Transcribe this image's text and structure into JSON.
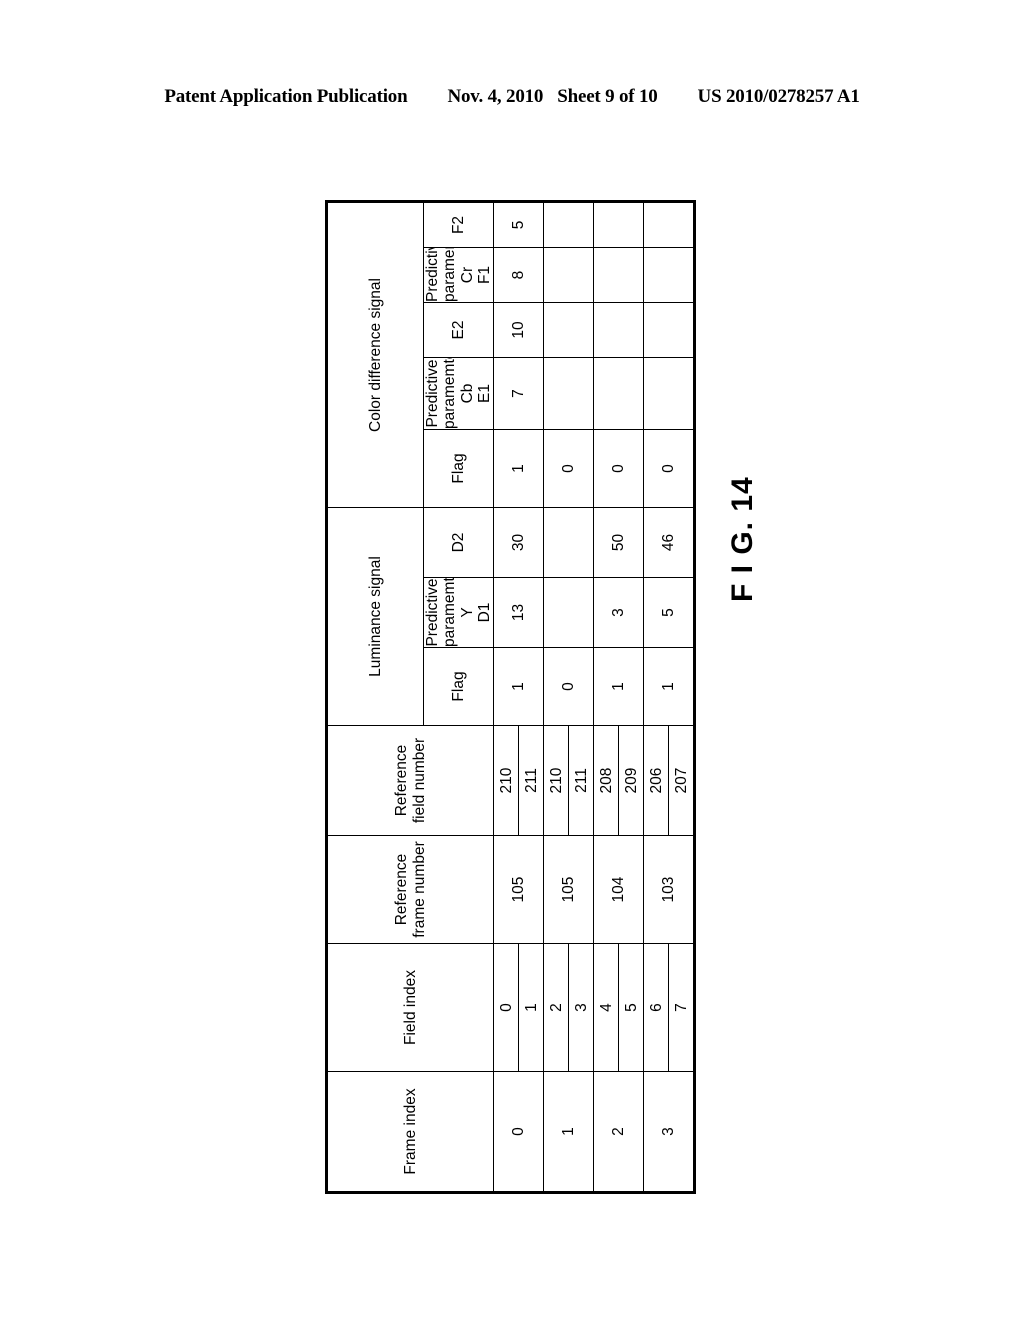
{
  "page": {
    "header": {
      "publication": "Patent Application Publication",
      "date": "Nov. 4, 2010",
      "sheet": "Sheet 9 of 10",
      "doc_number": "US 2010/0278257 A1"
    },
    "figure_label": "F I G. 14",
    "background_color": "#ffffff",
    "ink_color": "#000000"
  },
  "table": {
    "orientation": "rotated-90-ccw",
    "group_headers": {
      "color_difference": "Color difference signal",
      "luminance": "Luminance signal"
    },
    "columns": [
      {
        "key": "frame_index",
        "label": "Frame index"
      },
      {
        "key": "field_index",
        "label": "Field index"
      },
      {
        "key": "reference_frame_number",
        "label": "Reference\nframe number",
        "line1": "Reference",
        "line2": "frame number"
      },
      {
        "key": "reference_field_number",
        "label": "Reference\nfield number",
        "line1": "Reference",
        "line2": "field number"
      },
      {
        "key": "luminance_flag",
        "label": "Flag"
      },
      {
        "key": "luminance_d1",
        "group": "Predictive paramemter Y",
        "g_line1": "Predictive",
        "g_line2": "paramemter Y",
        "label": "D1"
      },
      {
        "key": "luminance_d2",
        "group": "Predictive paramemter Y",
        "g_line1": "Predictive",
        "g_line2": "paramemter Y",
        "label": "D2"
      },
      {
        "key": "color_flag",
        "label": "Flag"
      },
      {
        "key": "cb_e1",
        "group": "Predictive paramemter Cb",
        "g_line1": "Predictive",
        "g_line2": "paramemter Cb",
        "label": "E1"
      },
      {
        "key": "cb_e2",
        "group": "Predictive paramemter Cb",
        "g_line1": "Predictive",
        "g_line2": "paramemter Cb",
        "label": "E2"
      },
      {
        "key": "cr_f1",
        "group": "Predictive paramemter Cr",
        "g_line1": "Predictive",
        "g_line2": "paramemter Cr",
        "label": "F1"
      },
      {
        "key": "cr_f2",
        "group": "Predictive paramemter Cr",
        "g_line1": "Predictive",
        "g_line2": "paramemter Cr",
        "label": "F2"
      }
    ],
    "rows": [
      {
        "frame_index": "0",
        "field_index": [
          "0",
          "1"
        ],
        "reference_frame_number": "105",
        "reference_field_number": [
          "210",
          "211"
        ],
        "luminance_flag": "1",
        "luminance_d1": "13",
        "luminance_d2": "30",
        "color_flag": "1",
        "cb_e1": "7",
        "cb_e2": "10",
        "cr_f1": "8",
        "cr_f2": "5"
      },
      {
        "frame_index": "1",
        "field_index": [
          "2",
          "3"
        ],
        "reference_frame_number": "105",
        "reference_field_number": [
          "210",
          "211"
        ],
        "luminance_flag": "0",
        "luminance_d1": "",
        "luminance_d2": "",
        "color_flag": "0",
        "cb_e1": "",
        "cb_e2": "",
        "cr_f1": "",
        "cr_f2": ""
      },
      {
        "frame_index": "2",
        "field_index": [
          "4",
          "5"
        ],
        "reference_frame_number": "104",
        "reference_field_number": [
          "208",
          "209"
        ],
        "luminance_flag": "1",
        "luminance_d1": "3",
        "luminance_d2": "50",
        "color_flag": "0",
        "cb_e1": "",
        "cb_e2": "",
        "cr_f1": "",
        "cr_f2": ""
      },
      {
        "frame_index": "3",
        "field_index": [
          "6",
          "7"
        ],
        "reference_frame_number": "103",
        "reference_field_number": [
          "206",
          "207"
        ],
        "luminance_flag": "1",
        "luminance_d1": "5",
        "luminance_d2": "46",
        "color_flag": "0",
        "cb_e1": "",
        "cb_e2": "",
        "cr_f1": "",
        "cr_f2": ""
      }
    ]
  }
}
